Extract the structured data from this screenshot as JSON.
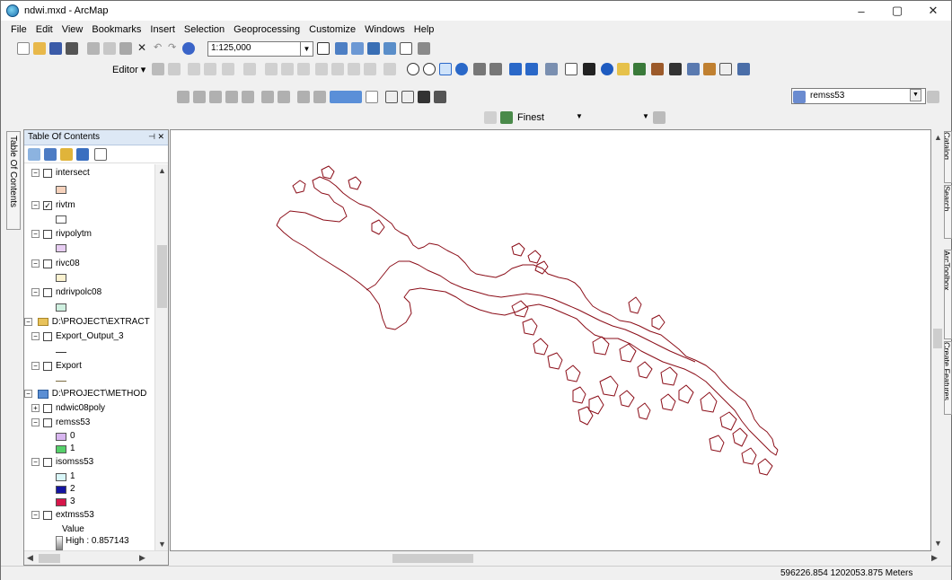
{
  "window": {
    "title": "ndwi.mxd - ArcMap",
    "min": "–",
    "max": "▢",
    "close": "✕"
  },
  "menu": [
    "File",
    "Edit",
    "View",
    "Bookmarks",
    "Insert",
    "Selection",
    "Geoprocessing",
    "Customize",
    "Windows",
    "Help"
  ],
  "toolbar": {
    "scale": "1:125,000",
    "editor_label": "Editor ▾",
    "snap_label": "Finest",
    "layer_select": "remss53"
  },
  "toc": {
    "header": "Table Of Contents",
    "sidetab": "Table Of Contents",
    "items": [
      {
        "label": "intersect",
        "checked": false
      },
      {
        "label": "rivtm",
        "checked": true
      },
      {
        "label": "rivpolytm",
        "checked": false
      },
      {
        "label": "rivc08",
        "checked": false
      },
      {
        "label": "ndrivpolc08",
        "checked": false
      },
      {
        "label": "D:\\PROJECT\\EXTRACT"
      },
      {
        "label": "Export_Output_3",
        "checked": false
      },
      {
        "label": "Export",
        "checked": false
      },
      {
        "label": "D:\\PROJECT\\METHOD"
      },
      {
        "label": "ndwic08poly",
        "checked": false
      },
      {
        "label": "remss53",
        "checked": false
      },
      {
        "label": "isomss53",
        "checked": false
      },
      {
        "label": "extmss53",
        "checked": false
      }
    ],
    "legend": {
      "remss53": [
        {
          "label": "0",
          "color": "#d8b6f0"
        },
        {
          "label": "1",
          "color": "#55d06a"
        }
      ],
      "isomss53": [
        {
          "label": "1",
          "color": "#d8f6f8"
        },
        {
          "label": "2",
          "color": "#1414a0"
        },
        {
          "label": "3",
          "color": "#d6164a"
        }
      ],
      "extmss53_value": "Value",
      "extmss53_high": "High : 0.857143"
    },
    "swatches": {
      "intersect": "#f6d2bc",
      "rivtm": "#ffffff",
      "rivpolytm": "#e7cdf2",
      "rivc08": "#fbf2d0",
      "ndrivpolc08": "#cff0e0",
      "export_output_3": "#333333",
      "export": "#7a6a40"
    }
  },
  "right_tabs": [
    "Catalog",
    "Search",
    "ArcToolbox",
    "Create Features"
  ],
  "status": {
    "coords": "596226.854  1202053.875 Meters"
  },
  "map": {
    "outline_color": "#8b0d18"
  }
}
